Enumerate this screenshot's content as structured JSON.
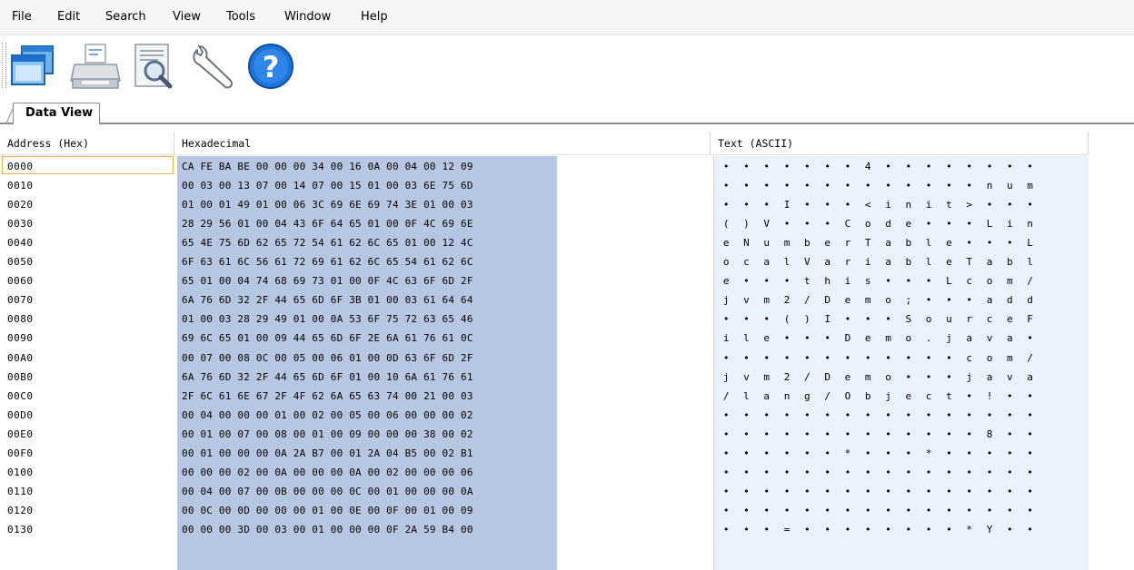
{
  "menu": [
    "File",
    "Edit",
    "Search",
    "View",
    "Tools",
    "Window",
    "Help"
  ],
  "toolbar": {
    "icons": [
      "open-windows-icon",
      "print-icon",
      "print-preview-icon",
      "settings-wrench-icon",
      "help-icon"
    ],
    "colors": {
      "help": "#1e73d8",
      "windows": "#2a7fd4"
    }
  },
  "tabs": [
    {
      "label": "Data View",
      "active": true
    }
  ],
  "columns": {
    "address": "Address (Hex)",
    "hex": "Hexadecimal",
    "text": "Text (ASCII)"
  },
  "colors": {
    "hex_selection": "#b7c7e1",
    "ascii_background": "#eaf2fc",
    "address_selection_border": "#f0b040"
  },
  "rows": [
    {
      "address": "0000",
      "hex": "CA FE BA BE 00 00 00 34 00 16 0A 00 04 00 12 09",
      "text": [
        "•",
        "•",
        "•",
        "•",
        "•",
        "•",
        "•",
        "4",
        "•",
        "•",
        "•",
        "•",
        "•",
        "•",
        "•",
        "•"
      ]
    },
    {
      "address": "0010",
      "hex": "00 03 00 13 07 00 14 07 00 15 01 00 03 6E 75 6D",
      "text": [
        "•",
        "•",
        "•",
        "•",
        "•",
        "•",
        "•",
        "•",
        "•",
        "•",
        "•",
        "•",
        "•",
        "n",
        "u",
        "m"
      ]
    },
    {
      "address": "0020",
      "hex": "01 00 01 49 01 00 06 3C 69 6E 69 74 3E 01 00 03",
      "text": [
        "•",
        "•",
        "•",
        "I",
        "•",
        "•",
        "•",
        "<",
        "i",
        "n",
        "i",
        "t",
        ">",
        "•",
        "•",
        "•"
      ]
    },
    {
      "address": "0030",
      "hex": "28 29 56 01 00 04 43 6F 64 65 01 00 0F 4C 69 6E",
      "text": [
        "(",
        ")",
        "V",
        "•",
        "•",
        "•",
        "C",
        "o",
        "d",
        "e",
        "•",
        "•",
        "•",
        "L",
        "i",
        "n"
      ]
    },
    {
      "address": "0040",
      "hex": "65 4E 75 6D 62 65 72 54 61 62 6C 65 01 00 12 4C",
      "text": [
        "e",
        "N",
        "u",
        "m",
        "b",
        "e",
        "r",
        "T",
        "a",
        "b",
        "l",
        "e",
        "•",
        "•",
        "•",
        "L"
      ]
    },
    {
      "address": "0050",
      "hex": "6F 63 61 6C 56 61 72 69 61 62 6C 65 54 61 62 6C",
      "text": [
        "o",
        "c",
        "a",
        "l",
        "V",
        "a",
        "r",
        "i",
        "a",
        "b",
        "l",
        "e",
        "T",
        "a",
        "b",
        "l"
      ]
    },
    {
      "address": "0060",
      "hex": "65 01 00 04 74 68 69 73 01 00 0F 4C 63 6F 6D 2F",
      "text": [
        "e",
        "•",
        "•",
        "•",
        "t",
        "h",
        "i",
        "s",
        "•",
        "•",
        "•",
        "L",
        "c",
        "o",
        "m",
        "/"
      ]
    },
    {
      "address": "0070",
      "hex": "6A 76 6D 32 2F 44 65 6D 6F 3B 01 00 03 61 64 64",
      "text": [
        "j",
        "v",
        "m",
        "2",
        "/",
        "D",
        "e",
        "m",
        "o",
        ";",
        "•",
        "•",
        "•",
        "a",
        "d",
        "d"
      ]
    },
    {
      "address": "0080",
      "hex": "01 00 03 28 29 49 01 00 0A 53 6F 75 72 63 65 46",
      "text": [
        "•",
        "•",
        "•",
        "(",
        ")",
        "I",
        "•",
        "•",
        "•",
        "S",
        "o",
        "u",
        "r",
        "c",
        "e",
        "F"
      ]
    },
    {
      "address": "0090",
      "hex": "69 6C 65 01 00 09 44 65 6D 6F 2E 6A 61 76 61 0C",
      "text": [
        "i",
        "l",
        "e",
        "•",
        "•",
        "•",
        "D",
        "e",
        "m",
        "o",
        ".",
        "j",
        "a",
        "v",
        "a",
        "•"
      ]
    },
    {
      "address": "00A0",
      "hex": "00 07 00 08 0C 00 05 00 06 01 00 0D 63 6F 6D 2F",
      "text": [
        "•",
        "•",
        "•",
        "•",
        "•",
        "•",
        "•",
        "•",
        "•",
        "•",
        "•",
        "•",
        "c",
        "o",
        "m",
        "/"
      ]
    },
    {
      "address": "00B0",
      "hex": "6A 76 6D 32 2F 44 65 6D 6F 01 00 10 6A 61 76 61",
      "text": [
        "j",
        "v",
        "m",
        "2",
        "/",
        "D",
        "e",
        "m",
        "o",
        "•",
        "•",
        "•",
        "j",
        "a",
        "v",
        "a"
      ]
    },
    {
      "address": "00C0",
      "hex": "2F 6C 61 6E 67 2F 4F 62 6A 65 63 74 00 21 00 03",
      "text": [
        "/",
        "l",
        "a",
        "n",
        "g",
        "/",
        "O",
        "b",
        "j",
        "e",
        "c",
        "t",
        "•",
        "!",
        "•",
        "•"
      ]
    },
    {
      "address": "00D0",
      "hex": "00 04 00 00 00 01 00 02 00 05 00 06 00 00 00 02",
      "text": [
        "•",
        "•",
        "•",
        "•",
        "•",
        "•",
        "•",
        "•",
        "•",
        "•",
        "•",
        "•",
        "•",
        "•",
        "•",
        "•"
      ]
    },
    {
      "address": "00E0",
      "hex": "00 01 00 07 00 08 00 01 00 09 00 00 00 38 00 02",
      "text": [
        "•",
        "•",
        "•",
        "•",
        "•",
        "•",
        "•",
        "•",
        "•",
        "•",
        "•",
        "•",
        "•",
        "8",
        "•",
        "•"
      ]
    },
    {
      "address": "00F0",
      "hex": "00 01 00 00 00 0A 2A B7 00 01 2A 04 B5 00 02 B1",
      "text": [
        "•",
        "•",
        "•",
        "•",
        "•",
        "•",
        "*",
        "•",
        "•",
        "•",
        "*",
        "•",
        "•",
        "•",
        "•",
        "•"
      ]
    },
    {
      "address": "0100",
      "hex": "00 00 00 02 00 0A 00 00 00 0A 00 02 00 00 00 06",
      "text": [
        "•",
        "•",
        "•",
        "•",
        "•",
        "•",
        "•",
        "•",
        "•",
        "•",
        "•",
        "•",
        "•",
        "•",
        "•",
        "•"
      ]
    },
    {
      "address": "0110",
      "hex": "00 04 00 07 00 0B 00 00 00 0C 00 01 00 00 00 0A",
      "text": [
        "•",
        "•",
        "•",
        "•",
        "•",
        "•",
        "•",
        "•",
        "•",
        "•",
        "•",
        "•",
        "•",
        "•",
        "•",
        "•"
      ]
    },
    {
      "address": "0120",
      "hex": "00 0C 00 0D 00 00 00 01 00 0E 00 0F 00 01 00 09",
      "text": [
        "•",
        "•",
        "•",
        "•",
        "•",
        "•",
        "•",
        "•",
        "•",
        "•",
        "•",
        "•",
        "•",
        "•",
        "•",
        "•"
      ]
    },
    {
      "address": "0130",
      "hex": "00 00 00 3D 00 03 00 01 00 00 00 0F 2A 59 B4 00",
      "text": [
        "•",
        "•",
        "•",
        "=",
        "•",
        "•",
        "•",
        "•",
        "•",
        "•",
        "•",
        "•",
        "*",
        "Y",
        "•",
        "•"
      ]
    }
  ]
}
